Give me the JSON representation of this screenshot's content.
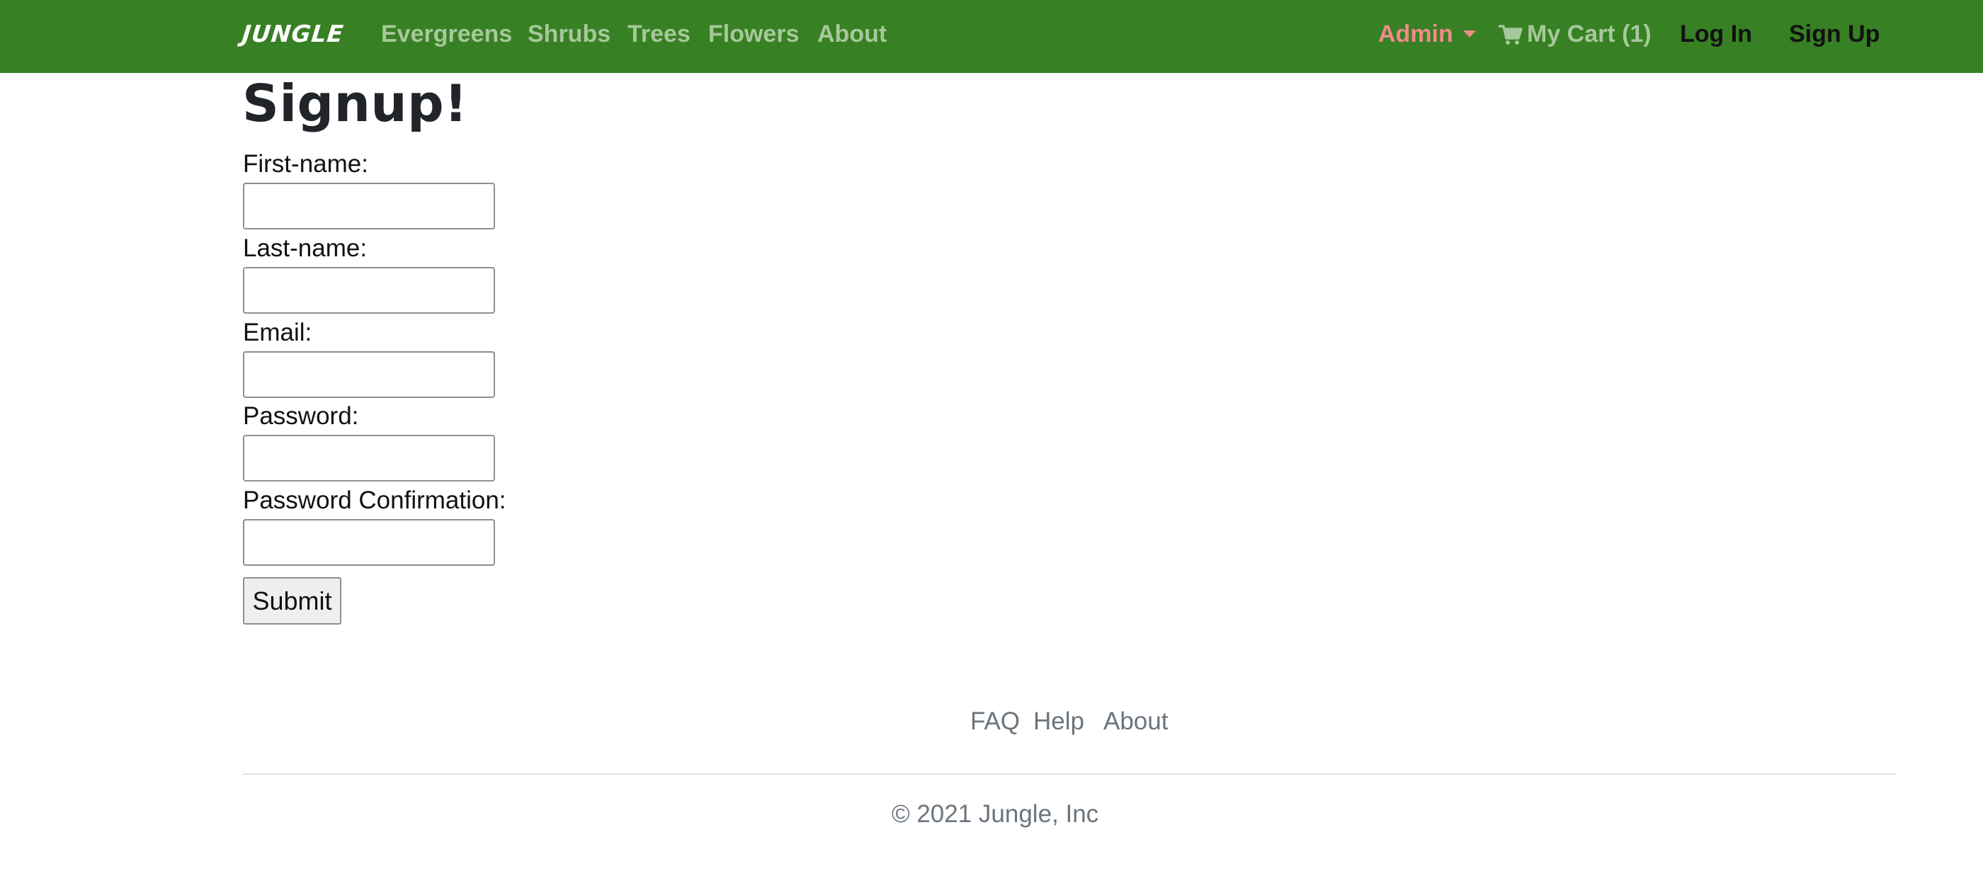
{
  "navbar": {
    "brand": "JUNGLE",
    "links": [
      "Evergreens",
      "Shrubs",
      "Trees",
      "Flowers",
      "About"
    ],
    "admin_label": "Admin",
    "cart_label": "My Cart (1)",
    "login_label": "Log In",
    "signup_label": "Sign Up",
    "icons": {
      "admin_dropdown": "caret-down-icon",
      "cart": "shopping-cart-icon"
    },
    "colors": {
      "background": "#378023",
      "link": "#a6c89a",
      "admin": "#ee8b87",
      "auth_links": "#111111"
    }
  },
  "main": {
    "title": "Signup!",
    "fields": [
      {
        "label": "First-name:",
        "value": ""
      },
      {
        "label": "Last-name:",
        "value": ""
      },
      {
        "label": "Email:",
        "value": ""
      },
      {
        "label": "Password:",
        "value": ""
      },
      {
        "label": "Password Confirmation:",
        "value": ""
      }
    ],
    "submit_label": "Submit"
  },
  "footer": {
    "links": [
      "FAQ",
      "Help",
      "About"
    ],
    "copyright": "© 2021 Jungle, Inc"
  }
}
